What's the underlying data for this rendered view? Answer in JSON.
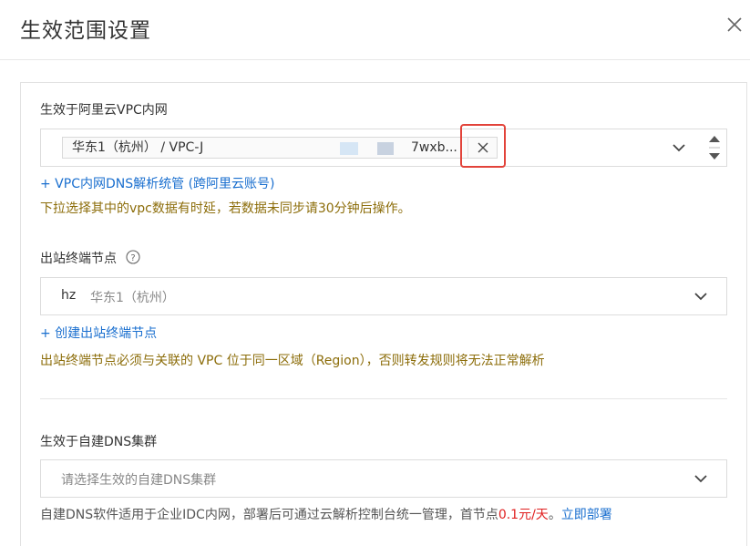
{
  "dialog": {
    "title": "生效范围设置",
    "close_icon": "close-icon"
  },
  "vpc_section": {
    "label": "生效于阿里云VPC内网",
    "tag_text": "华东1（杭州） / VPC-J",
    "tag_suffix": "7wxb...",
    "add_link": "+ VPC内网DNS解析统管 (跨阿里云账号)",
    "warning": "下拉选择其中的vpc数据有时延，若数据未同步请30分钟后操作。"
  },
  "outbound_section": {
    "label": "出站终端节点",
    "selected_code": "hz",
    "selected_region": "华东1（杭州）",
    "create_link": "+ 创建出站终端节点",
    "warning": "出站终端节点必须与关联的 VPC 位于同一区域（Region），否则转发规则将无法正常解析"
  },
  "dns_section": {
    "label": "生效于自建DNS集群",
    "placeholder": "请选择生效的自建DNS集群",
    "help_prefix": "自建DNS软件适用于企业IDC内网，部署后可通过云解析控制台统一管理，首节点",
    "price": "0.1元/天",
    "help_dot": "。",
    "deploy_link": "立即部署"
  },
  "colors": {
    "link": "#1a6fcf",
    "warning": "#8c6d0a",
    "price": "#e02020",
    "highlight": "#e2433a"
  }
}
